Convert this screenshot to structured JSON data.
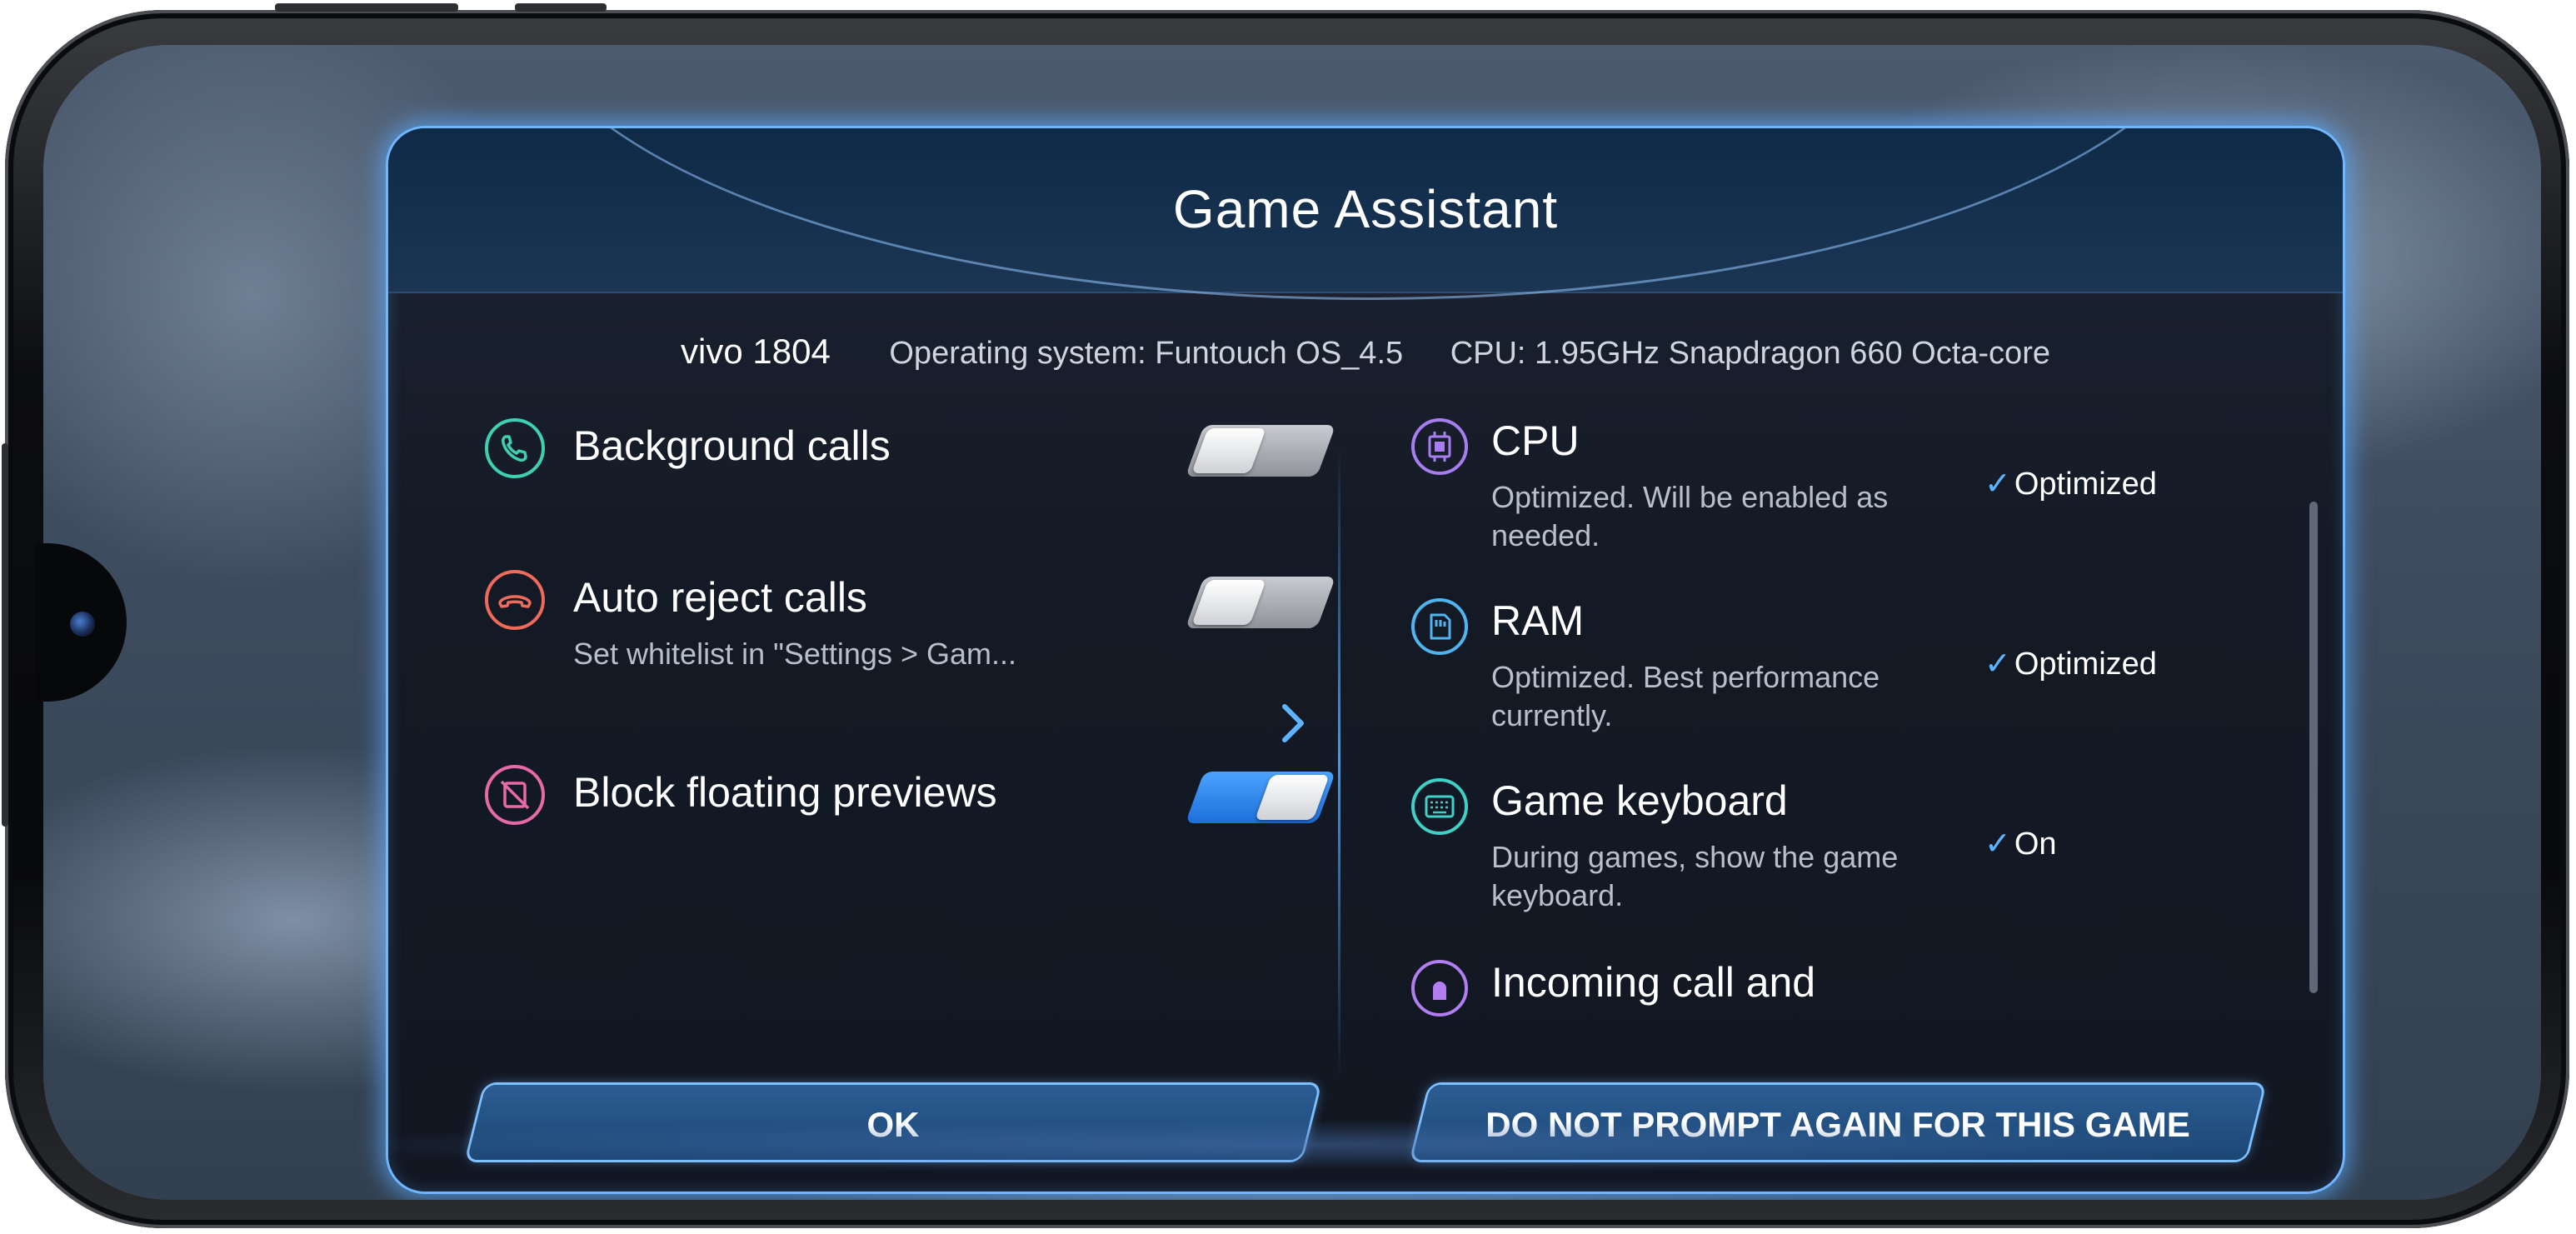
{
  "dialog": {
    "title": "Game Assistant"
  },
  "device": {
    "model": "vivo 1804",
    "os": "Operating system: Funtouch OS_4.5",
    "cpu": "CPU: 1.95GHz Snapdragon 660 Octa-core"
  },
  "features": [
    {
      "label": "Background calls",
      "subtitle": "",
      "enabled": false,
      "icon": "phone-icon",
      "color": "#3fd0b4"
    },
    {
      "label": "Auto reject calls",
      "subtitle": "Set whitelist in \"Settings > Gam...",
      "enabled": false,
      "icon": "phone-hangup-icon",
      "color": "#ef6a5a"
    },
    {
      "label": "Block floating previews",
      "subtitle": "",
      "enabled": true,
      "icon": "block-preview-icon",
      "color": "#e76aa8"
    }
  ],
  "optimizations": [
    {
      "title": "CPU",
      "description": "Optimized. Will be enabled as needed.",
      "status": "Optimized",
      "icon": "cpu-icon",
      "color": "#a77ef0"
    },
    {
      "title": "RAM",
      "description": "Optimized. Best performance currently.",
      "status": "Optimized",
      "icon": "ram-icon",
      "color": "#4fb4f0"
    },
    {
      "title": "Game keyboard",
      "description": "During games, show the game keyboard.",
      "status": "On",
      "icon": "keyboard-icon",
      "color": "#3fd0c6"
    },
    {
      "title": "Incoming call and",
      "description": "",
      "status": "",
      "icon": "bell-icon",
      "color": "#b07ef0"
    }
  ],
  "buttons": {
    "ok": "OK",
    "dont_prompt": "DO NOT PROMPT AGAIN FOR THIS GAME"
  },
  "colors": {
    "accent": "#5eb4ff",
    "toggle_on": "#2a84ec",
    "button_fill": "#24527f"
  }
}
